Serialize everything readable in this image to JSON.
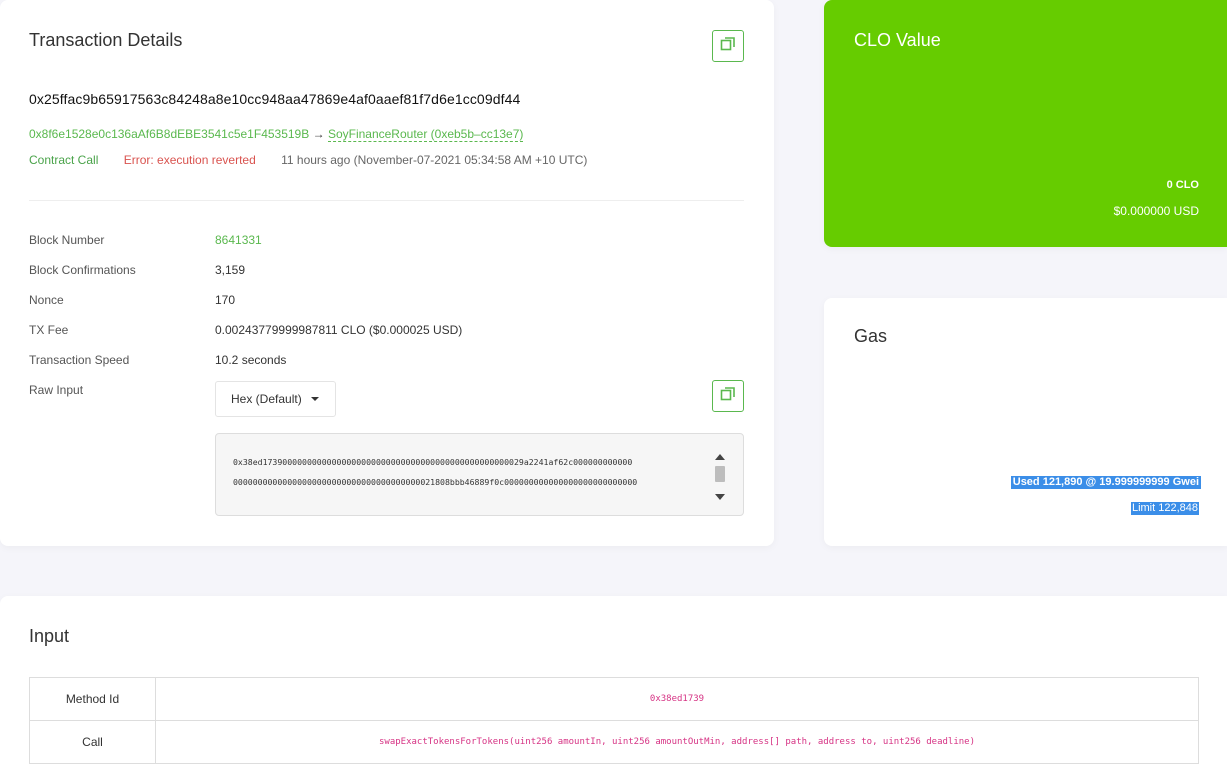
{
  "transaction": {
    "title": "Transaction Details",
    "hash": "0x25ffac9b65917563c84248a8e10cc948aa47869e4af0aaef81f7d6e1cc09df44",
    "from": "0x8f6e1528e0c136aAf6B8dEBE3541c5e1F453519B",
    "arrow": "→",
    "to": "SoyFinanceRouter (0xeb5b–cc13e7)",
    "type_badge": "Contract Call",
    "status_badge": "Error: execution reverted",
    "timestamp": "11 hours ago (November-07-2021 05:34:58 AM +10 UTC)",
    "rows": {
      "block_number_label": "Block Number",
      "block_number": "8641331",
      "confirmations_label": "Block Confirmations",
      "confirmations": "3,159",
      "nonce_label": "Nonce",
      "nonce": "170",
      "fee_label": "TX Fee",
      "fee": "0.00243779999987811 CLO ($0.000025 USD)",
      "speed_label": "Transaction Speed",
      "speed": "10.2 seconds",
      "raw_label": "Raw Input"
    },
    "raw_format": "Hex (Default)",
    "raw_line1": "0x38ed17390000000000000000000000000000000000000000000000029a2241af62c000000000000",
    "raw_line2": "00000000000000000000000000000000000000021808bbb46889f0c000000000000000000000000000"
  },
  "clo": {
    "title": "CLO Value",
    "amount": "0 CLO",
    "usd": "$0.000000 USD"
  },
  "gas": {
    "title": "Gas",
    "used": "Used 121,890 @ 19.999999999 Gwei",
    "limit": "Limit 122,848"
  },
  "input": {
    "title": "Input",
    "method_label": "Method Id",
    "method_value": "0x38ed1739",
    "call_label": "Call",
    "call_value": "swapExactTokensForTokens(uint256 amountIn, uint256 amountOutMin, address[] path, address to, uint256 deadline)"
  },
  "colors": {
    "accent_green": "#5ab84e",
    "clo_card_bg": "#66cc00",
    "error_red": "#d9534f",
    "selection_blue": "#3b8ee8",
    "code_pink": "#d63384"
  },
  "icons": {
    "copy": "copy-icon"
  }
}
